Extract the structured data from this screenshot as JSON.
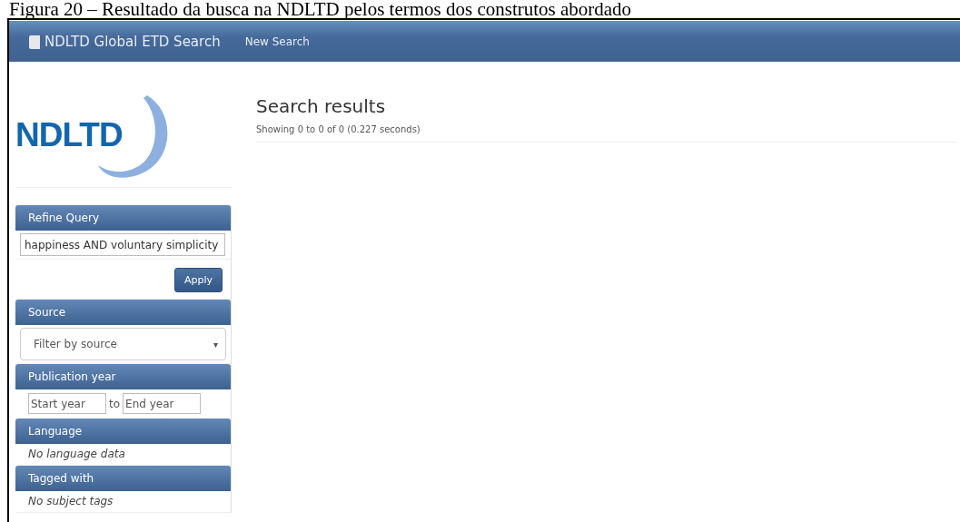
{
  "caption": "Figura 20 – Resultado da busca na NDLTD pelos termos dos construtos abordado",
  "navbar": {
    "brand": "NDLTD Global ETD Search",
    "links": [
      "New Search"
    ]
  },
  "logo": {
    "text": "NDLTD"
  },
  "results": {
    "title": "Search results",
    "summary": "Showing 0 to 0 of 0 (0.227 seconds)"
  },
  "sidebar": [
    {
      "kind": "query",
      "title": "Refine Query",
      "value": "happiness AND voluntary simplicity",
      "button": "Apply"
    },
    {
      "kind": "select",
      "title": "Source",
      "placeholder": "Filter by source",
      "caret": "▾"
    },
    {
      "kind": "range",
      "title": "Publication year",
      "from_placeholder": "Start year",
      "separator": "to",
      "to_placeholder": "End year"
    },
    {
      "kind": "note",
      "title": "Language",
      "text": "No language data"
    },
    {
      "kind": "note",
      "title": "Tagged with",
      "text": "No subject tags"
    }
  ]
}
